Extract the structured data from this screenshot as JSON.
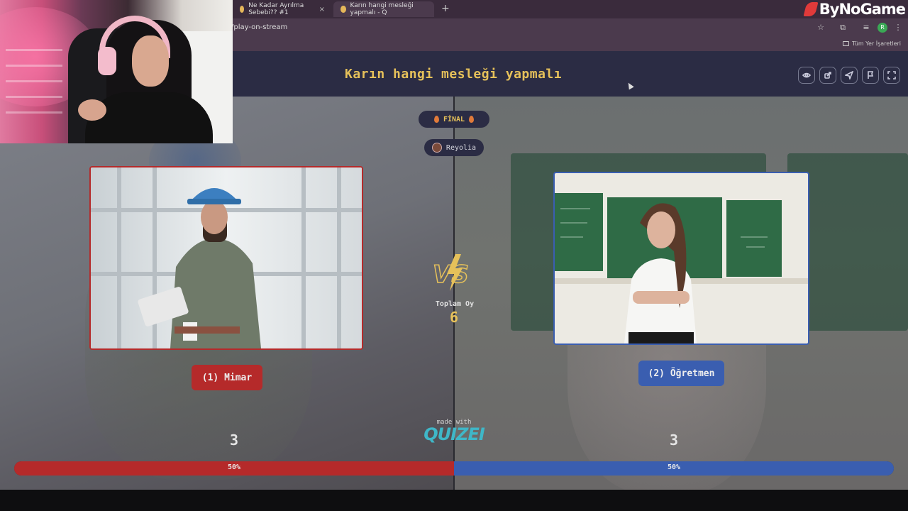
{
  "browser": {
    "tabs": [
      {
        "label": "Ne Kadar Ayrılma Sebebi?? #1"
      },
      {
        "label": "Karın hangi mesleği yapmalı - Q"
      }
    ],
    "tab_close_glyph": "×",
    "new_tab_glyph": "+",
    "url": "/play-on-stream",
    "bookmarks_label": "Tüm Yer İşaretleri",
    "profile_initial": "R"
  },
  "watermark": {
    "brand": "ByNoGame"
  },
  "quiz": {
    "title": "Karın hangi mesleği yapmalı",
    "header_buttons": [
      "eye-icon",
      "share-icon",
      "send-icon",
      "flag-icon",
      "fullscreen-icon"
    ],
    "round_label": "FİNAL",
    "streamer": "Reyolia",
    "vs_label": "VS",
    "total_votes_label": "Toplam Oy",
    "total_votes": "6",
    "options": [
      {
        "label": "(1) Mimar",
        "votes": "3",
        "percent_label": "50%",
        "share": 0.5,
        "color": "#b52a2a"
      },
      {
        "label": "(2) Öğretmen",
        "votes": "3",
        "percent_label": "50%",
        "share": 0.5,
        "color": "#3a5eb0"
      }
    ],
    "made_with": "made with",
    "made_with_brand": "QUIZEI"
  },
  "colors": {
    "accent": "#e6c15a",
    "header_bg": "#2b2c44",
    "left_option": "#b52a2a",
    "right_option": "#3a5eb0",
    "brand_teal": "#3fb7c8"
  }
}
